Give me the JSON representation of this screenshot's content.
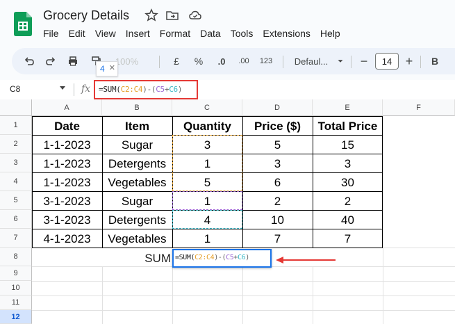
{
  "app": {
    "title": "Grocery Details",
    "menu": [
      "File",
      "Edit",
      "View",
      "Insert",
      "Format",
      "Data",
      "Tools",
      "Extensions",
      "Help"
    ]
  },
  "toolbar": {
    "zoom": "100%",
    "currency": "£",
    "percent": "%",
    "decrease_decimal": ".0",
    "number_format": "123",
    "font": "Defaul...",
    "font_size": "14",
    "bold": "B",
    "hint_value": "4"
  },
  "formula_bar": {
    "cell_ref": "C8",
    "formula_parts": [
      {
        "text": "=SUM(",
        "color": "plain"
      },
      {
        "text": "C2:C4",
        "color": "orange"
      },
      {
        "text": ")-(",
        "color": "grey"
      },
      {
        "text": "C5",
        "color": "purple"
      },
      {
        "text": "+",
        "color": "grey"
      },
      {
        "text": "C6",
        "color": "teal"
      },
      {
        "text": ")",
        "color": "grey"
      }
    ]
  },
  "sheet": {
    "columns": [
      "A",
      "B",
      "C",
      "D",
      "E",
      "F"
    ],
    "rows": [
      "1",
      "2",
      "3",
      "4",
      "5",
      "6",
      "7",
      "8",
      "9",
      "10",
      "11",
      "12"
    ],
    "active_row": "12",
    "headers": [
      "Date",
      "Item",
      "Quantity",
      "Price ($)",
      "Total Price"
    ],
    "data": [
      [
        "1-1-2023",
        "Sugar",
        "3",
        "5",
        "15"
      ],
      [
        "1-1-2023",
        "Detergents",
        "1",
        "3",
        "3"
      ],
      [
        "1-1-2023",
        "Vegetables",
        "5",
        "6",
        "30"
      ],
      [
        "3-1-2023",
        "Sugar",
        "1",
        "2",
        "2"
      ],
      [
        "3-1-2023",
        "Detergents",
        "4",
        "10",
        "40"
      ],
      [
        "4-1-2023",
        "Vegetables",
        "1",
        "7",
        "7"
      ]
    ],
    "sum_label": "SUM"
  },
  "colors": {
    "highlight_red": "#e53935",
    "edit_blue": "#1a73e8",
    "range_orange": "#e59e25",
    "range_purple": "#9c6ad6",
    "range_teal": "#3ab7c6"
  }
}
